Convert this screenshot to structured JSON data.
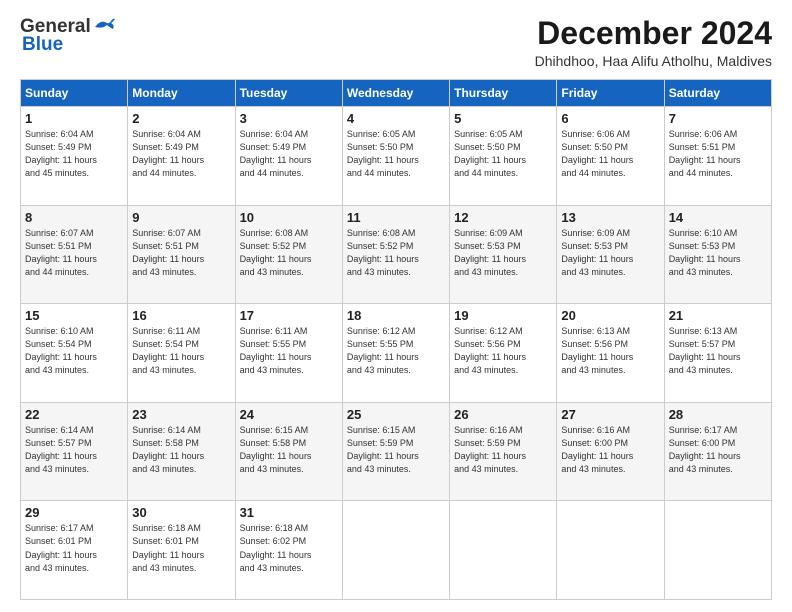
{
  "logo": {
    "general": "General",
    "blue": "Blue"
  },
  "header": {
    "month": "December 2024",
    "location": "Dhihdhoo, Haa Alifu Atholhu, Maldives"
  },
  "days": [
    "Sunday",
    "Monday",
    "Tuesday",
    "Wednesday",
    "Thursday",
    "Friday",
    "Saturday"
  ],
  "weeks": [
    [
      {
        "day": "1",
        "info": "Sunrise: 6:04 AM\nSunset: 5:49 PM\nDaylight: 11 hours\nand 45 minutes."
      },
      {
        "day": "2",
        "info": "Sunrise: 6:04 AM\nSunset: 5:49 PM\nDaylight: 11 hours\nand 44 minutes."
      },
      {
        "day": "3",
        "info": "Sunrise: 6:04 AM\nSunset: 5:49 PM\nDaylight: 11 hours\nand 44 minutes."
      },
      {
        "day": "4",
        "info": "Sunrise: 6:05 AM\nSunset: 5:50 PM\nDaylight: 11 hours\nand 44 minutes."
      },
      {
        "day": "5",
        "info": "Sunrise: 6:05 AM\nSunset: 5:50 PM\nDaylight: 11 hours\nand 44 minutes."
      },
      {
        "day": "6",
        "info": "Sunrise: 6:06 AM\nSunset: 5:50 PM\nDaylight: 11 hours\nand 44 minutes."
      },
      {
        "day": "7",
        "info": "Sunrise: 6:06 AM\nSunset: 5:51 PM\nDaylight: 11 hours\nand 44 minutes."
      }
    ],
    [
      {
        "day": "8",
        "info": "Sunrise: 6:07 AM\nSunset: 5:51 PM\nDaylight: 11 hours\nand 44 minutes."
      },
      {
        "day": "9",
        "info": "Sunrise: 6:07 AM\nSunset: 5:51 PM\nDaylight: 11 hours\nand 43 minutes."
      },
      {
        "day": "10",
        "info": "Sunrise: 6:08 AM\nSunset: 5:52 PM\nDaylight: 11 hours\nand 43 minutes."
      },
      {
        "day": "11",
        "info": "Sunrise: 6:08 AM\nSunset: 5:52 PM\nDaylight: 11 hours\nand 43 minutes."
      },
      {
        "day": "12",
        "info": "Sunrise: 6:09 AM\nSunset: 5:53 PM\nDaylight: 11 hours\nand 43 minutes."
      },
      {
        "day": "13",
        "info": "Sunrise: 6:09 AM\nSunset: 5:53 PM\nDaylight: 11 hours\nand 43 minutes."
      },
      {
        "day": "14",
        "info": "Sunrise: 6:10 AM\nSunset: 5:53 PM\nDaylight: 11 hours\nand 43 minutes."
      }
    ],
    [
      {
        "day": "15",
        "info": "Sunrise: 6:10 AM\nSunset: 5:54 PM\nDaylight: 11 hours\nand 43 minutes."
      },
      {
        "day": "16",
        "info": "Sunrise: 6:11 AM\nSunset: 5:54 PM\nDaylight: 11 hours\nand 43 minutes."
      },
      {
        "day": "17",
        "info": "Sunrise: 6:11 AM\nSunset: 5:55 PM\nDaylight: 11 hours\nand 43 minutes."
      },
      {
        "day": "18",
        "info": "Sunrise: 6:12 AM\nSunset: 5:55 PM\nDaylight: 11 hours\nand 43 minutes."
      },
      {
        "day": "19",
        "info": "Sunrise: 6:12 AM\nSunset: 5:56 PM\nDaylight: 11 hours\nand 43 minutes."
      },
      {
        "day": "20",
        "info": "Sunrise: 6:13 AM\nSunset: 5:56 PM\nDaylight: 11 hours\nand 43 minutes."
      },
      {
        "day": "21",
        "info": "Sunrise: 6:13 AM\nSunset: 5:57 PM\nDaylight: 11 hours\nand 43 minutes."
      }
    ],
    [
      {
        "day": "22",
        "info": "Sunrise: 6:14 AM\nSunset: 5:57 PM\nDaylight: 11 hours\nand 43 minutes."
      },
      {
        "day": "23",
        "info": "Sunrise: 6:14 AM\nSunset: 5:58 PM\nDaylight: 11 hours\nand 43 minutes."
      },
      {
        "day": "24",
        "info": "Sunrise: 6:15 AM\nSunset: 5:58 PM\nDaylight: 11 hours\nand 43 minutes."
      },
      {
        "day": "25",
        "info": "Sunrise: 6:15 AM\nSunset: 5:59 PM\nDaylight: 11 hours\nand 43 minutes."
      },
      {
        "day": "26",
        "info": "Sunrise: 6:16 AM\nSunset: 5:59 PM\nDaylight: 11 hours\nand 43 minutes."
      },
      {
        "day": "27",
        "info": "Sunrise: 6:16 AM\nSunset: 6:00 PM\nDaylight: 11 hours\nand 43 minutes."
      },
      {
        "day": "28",
        "info": "Sunrise: 6:17 AM\nSunset: 6:00 PM\nDaylight: 11 hours\nand 43 minutes."
      }
    ],
    [
      {
        "day": "29",
        "info": "Sunrise: 6:17 AM\nSunset: 6:01 PM\nDaylight: 11 hours\nand 43 minutes."
      },
      {
        "day": "30",
        "info": "Sunrise: 6:18 AM\nSunset: 6:01 PM\nDaylight: 11 hours\nand 43 minutes."
      },
      {
        "day": "31",
        "info": "Sunrise: 6:18 AM\nSunset: 6:02 PM\nDaylight: 11 hours\nand 43 minutes."
      },
      {
        "day": "",
        "info": ""
      },
      {
        "day": "",
        "info": ""
      },
      {
        "day": "",
        "info": ""
      },
      {
        "day": "",
        "info": ""
      }
    ]
  ]
}
